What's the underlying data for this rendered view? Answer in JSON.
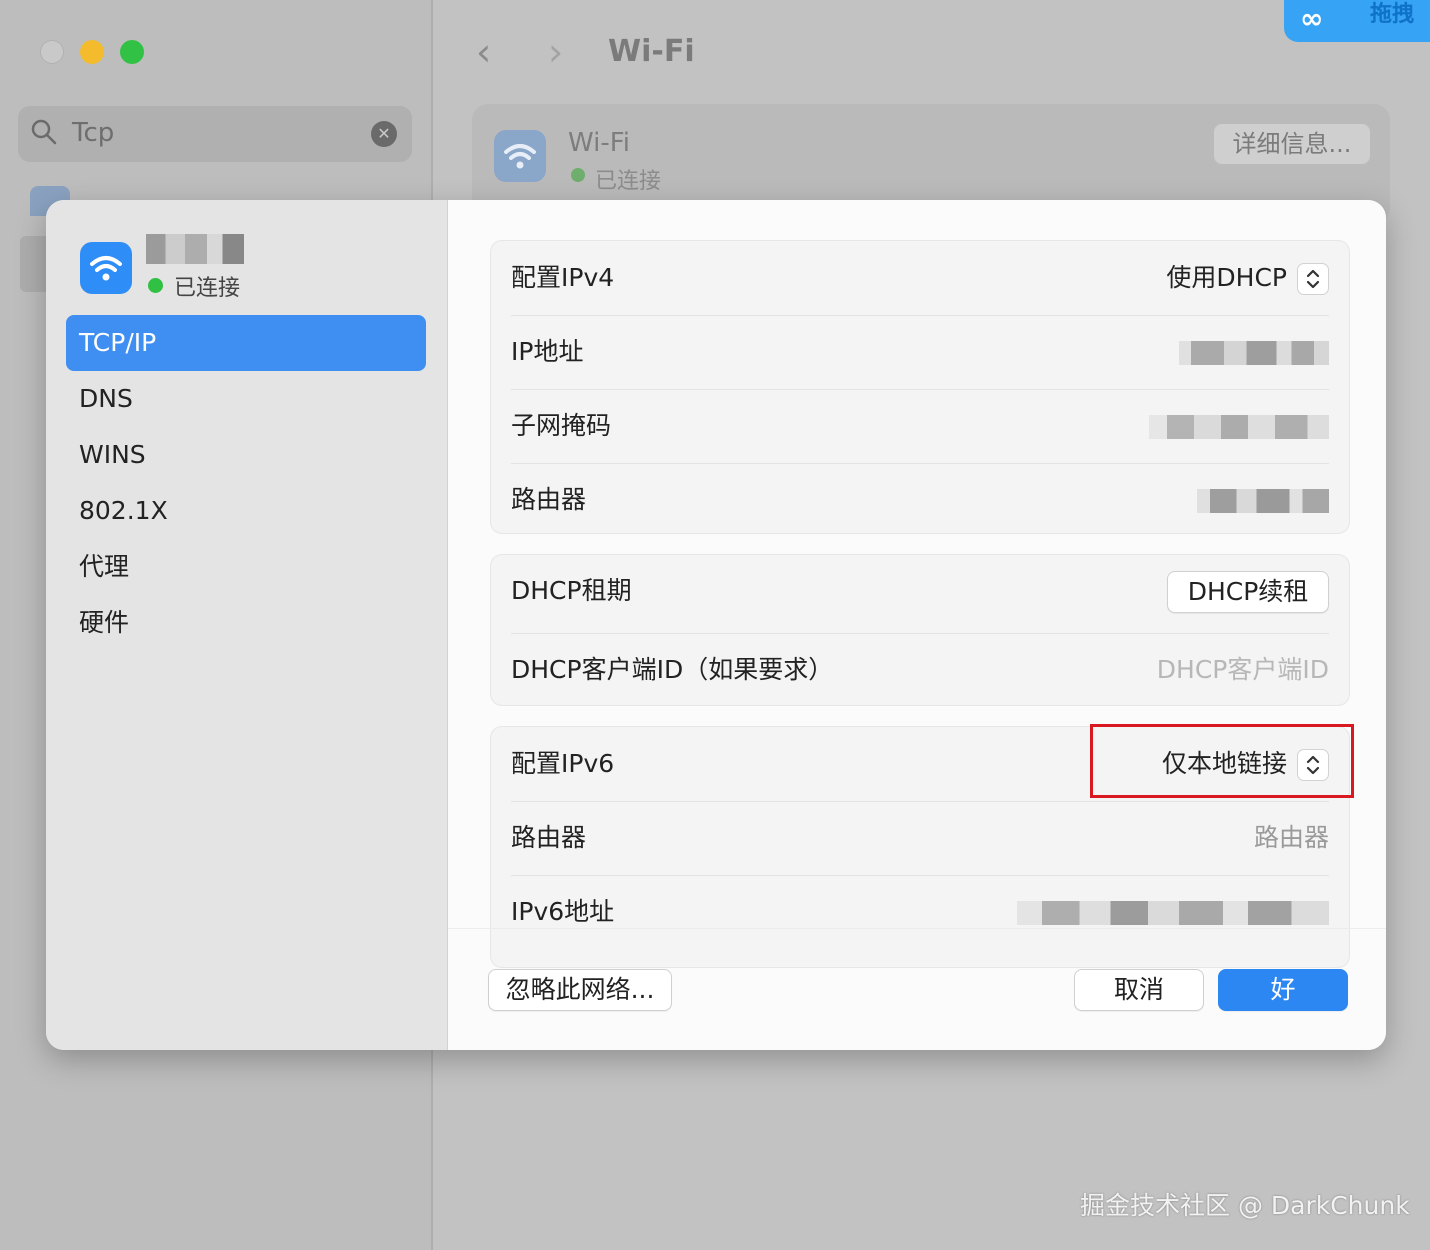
{
  "background_window": {
    "search_value": "Tcp",
    "nav_back": "‹",
    "nav_forward": "›",
    "title": "Wi-Fi",
    "wifi_name": "Wi-Fi",
    "wifi_status": "已连接",
    "details_button": "详细信息...",
    "app_badge_text": "拖拽"
  },
  "dialog": {
    "network_status": "已连接",
    "sidebar": {
      "items": [
        {
          "label": "TCP/IP",
          "active": true
        },
        {
          "label": "DNS"
        },
        {
          "label": "WINS"
        },
        {
          "label": "802.1X"
        },
        {
          "label": "代理"
        },
        {
          "label": "硬件"
        }
      ]
    },
    "ipv4": {
      "configure_label": "配置IPv4",
      "configure_value": "使用DHCP",
      "ip_label": "IP地址",
      "subnet_label": "子网掩码",
      "router_label": "路由器"
    },
    "dhcp": {
      "lease_label": "DHCP租期",
      "renew_button": "DHCP续租",
      "client_id_label": "DHCP客户端ID（如果要求）",
      "client_id_placeholder": "DHCP客户端ID"
    },
    "ipv6": {
      "configure_label": "配置IPv6",
      "configure_value": "仅本地链接",
      "router_label": "路由器",
      "router_placeholder": "路由器",
      "address_label": "IPv6地址"
    },
    "footer": {
      "forget_button": "忽略此网络...",
      "cancel_button": "取消",
      "ok_button": "好"
    }
  },
  "watermark": "掘金技术社区 @ DarkChunk",
  "colors": {
    "accent": "#2c87f2",
    "sidebar_selected": "#3f8ef2",
    "status_green": "#2fc044",
    "highlight_red": "#d9181f"
  }
}
